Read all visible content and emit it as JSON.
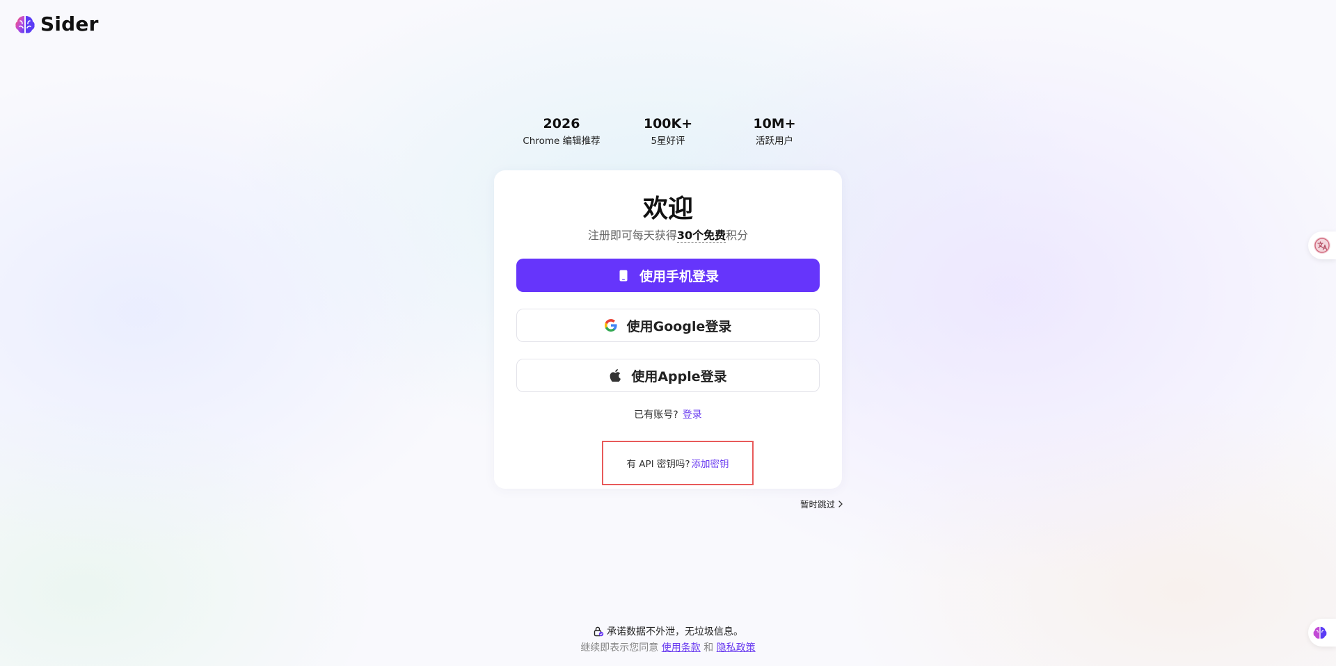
{
  "brand": {
    "name": "Sider",
    "logo_icon": "sider-brain-logo-icon",
    "colors": {
      "primary": "#6635fb",
      "link": "#6a3cf0",
      "highlight_border": "#e85a5a"
    }
  },
  "stats": [
    {
      "value": "2026",
      "label": "Chrome 编辑推荐"
    },
    {
      "value": "100K+",
      "label": "5星好评"
    },
    {
      "value": "10M+",
      "label": "活跃用户"
    }
  ],
  "card": {
    "title": "欢迎",
    "subtitle_before": "注册即可每天获得",
    "subtitle_highlight": "30个免费",
    "subtitle_after": "积分",
    "buttons": {
      "phone": {
        "label": "使用手机登录",
        "icon": "phone-icon"
      },
      "google": {
        "label": "使用Google登录",
        "icon": "google-icon"
      },
      "apple": {
        "label": "使用Apple登录",
        "icon": "apple-icon"
      }
    },
    "account": {
      "prompt": "已有账号?",
      "link": "登录"
    },
    "api": {
      "prompt": "有 API 密钥吗?",
      "link": "添加密钥"
    }
  },
  "skip": {
    "label": "暂时跳过",
    "icon": "chevron-right-icon"
  },
  "footer": {
    "privacy": "承诺数据不外泄，无垃圾信息。",
    "privacy_icon": "lock-icon",
    "agree_prefix": "继续即表示您同意",
    "terms": "使用条款",
    "and": "和",
    "privacy_policy": "隐私政策"
  }
}
